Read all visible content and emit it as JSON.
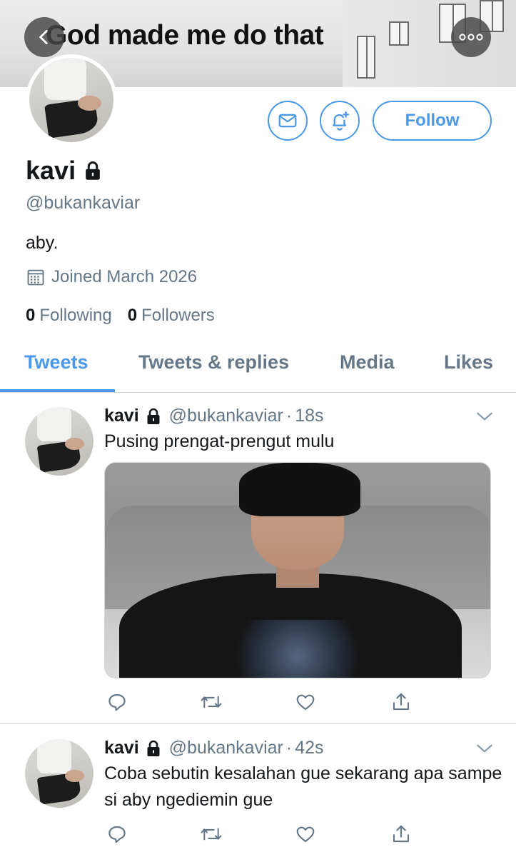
{
  "header": {
    "banner_text": "God made me do that",
    "back_icon": "chevron-left-icon",
    "more_icon": "more-icon"
  },
  "profile": {
    "name": "kavi",
    "handle": "@bukankaviar",
    "bio": "aby.",
    "joined": "Joined March 2026",
    "following_count": "0",
    "following_label": "Following",
    "followers_count": "0",
    "followers_label": "Followers",
    "follow_label": "Follow",
    "locked": true
  },
  "tabs": [
    {
      "label": "Tweets",
      "active": true
    },
    {
      "label": "Tweets & replies",
      "active": false
    },
    {
      "label": "Media",
      "active": false
    },
    {
      "label": "Likes",
      "active": false
    }
  ],
  "tweets": [
    {
      "name": "kavi",
      "handle": "@bukankaviar",
      "sep": "·",
      "time": "18s",
      "text": "Pusing prengat-prengut mulu",
      "has_media": true
    },
    {
      "name": "kavi",
      "handle": "@bukankaviar",
      "sep": "·",
      "time": "42s",
      "text": "Coba sebutin kesalahan gue sekarang apa sampe si aby ngediemin gue",
      "has_media": false
    }
  ],
  "colors": {
    "accent": "#4a99e9",
    "secondary_text": "#657786",
    "primary_text": "#14171a"
  }
}
